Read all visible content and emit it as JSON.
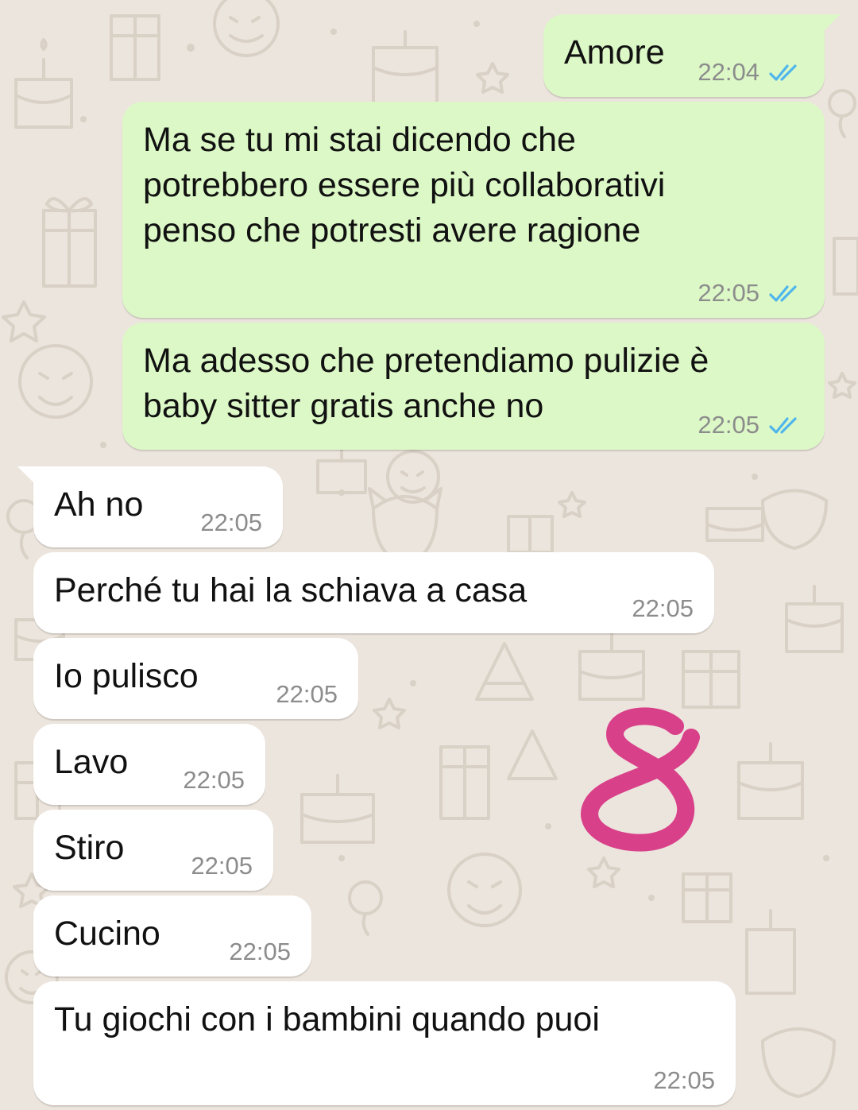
{
  "colors": {
    "outgoing_bubble": "#dcf8c6",
    "incoming_bubble": "#ffffff",
    "chat_background": "#ece5dd",
    "read_ticks": "#4fb6ec",
    "timestamp": "#8c8c8c",
    "annotation": "#d9408a"
  },
  "icons": {
    "read_receipt": "double-check-icon",
    "annotation": "handwritten-number-8"
  },
  "messages": [
    {
      "direction": "outgoing",
      "text": "Amore",
      "time": "22:04",
      "status": "read"
    },
    {
      "direction": "outgoing",
      "text": "Ma se tu mi stai dicendo che\npotrebbero essere più collaborativi\npenso che potresti avere ragione",
      "time": "22:05",
      "status": "read"
    },
    {
      "direction": "outgoing",
      "text": "Ma adesso che pretendiamo pulizie è\nbaby sitter gratis anche no",
      "time": "22:05",
      "status": "read"
    },
    {
      "direction": "incoming",
      "text": "Ah no",
      "time": "22:05"
    },
    {
      "direction": "incoming",
      "text": "Perché tu hai la schiava a casa",
      "time": "22:05"
    },
    {
      "direction": "incoming",
      "text": "Io pulisco",
      "time": "22:05"
    },
    {
      "direction": "incoming",
      "text": "Lavo",
      "time": "22:05"
    },
    {
      "direction": "incoming",
      "text": "Stiro",
      "time": "22:05"
    },
    {
      "direction": "incoming",
      "text": "Cucino",
      "time": "22:05"
    },
    {
      "direction": "incoming",
      "text": "Tu giochi con i bambini quando puoi",
      "time": "22:05"
    }
  ]
}
